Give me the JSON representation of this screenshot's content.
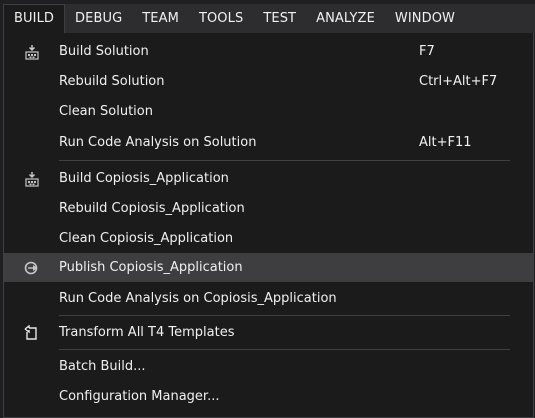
{
  "menubar": {
    "items": [
      "BUILD",
      "DEBUG",
      "TEAM",
      "TOOLS",
      "TEST",
      "ANALYZE",
      "WINDOW"
    ]
  },
  "menu": {
    "items": [
      {
        "label": "Build Solution",
        "shortcut": "F7",
        "icon": "build-solution-icon"
      },
      {
        "label": "Rebuild Solution",
        "shortcut": "Ctrl+Alt+F7"
      },
      {
        "label": "Clean Solution",
        "shortcut": ""
      },
      {
        "label": "Run Code Analysis on Solution",
        "shortcut": "Alt+F11"
      },
      {
        "label": "Build Copiosis_Application",
        "shortcut": "",
        "icon": "build-project-icon"
      },
      {
        "label": "Rebuild Copiosis_Application",
        "shortcut": ""
      },
      {
        "label": "Clean Copiosis_Application",
        "shortcut": ""
      },
      {
        "label": "Publish Copiosis_Application",
        "shortcut": "",
        "icon": "publish-icon",
        "highlighted": true
      },
      {
        "label": "Run Code Analysis on Copiosis_Application",
        "shortcut": ""
      },
      {
        "label": "Transform All T4 Templates",
        "shortcut": "",
        "icon": "transform-templates-icon"
      },
      {
        "label": "Batch Build...",
        "shortcut": ""
      },
      {
        "label": "Configuration Manager...",
        "shortcut": ""
      }
    ]
  },
  "colors": {
    "menu_background": "#1b1b1c",
    "menubar_background": "#2d2d30",
    "highlight": "#3e3e40",
    "text": "#f1f1f1"
  }
}
